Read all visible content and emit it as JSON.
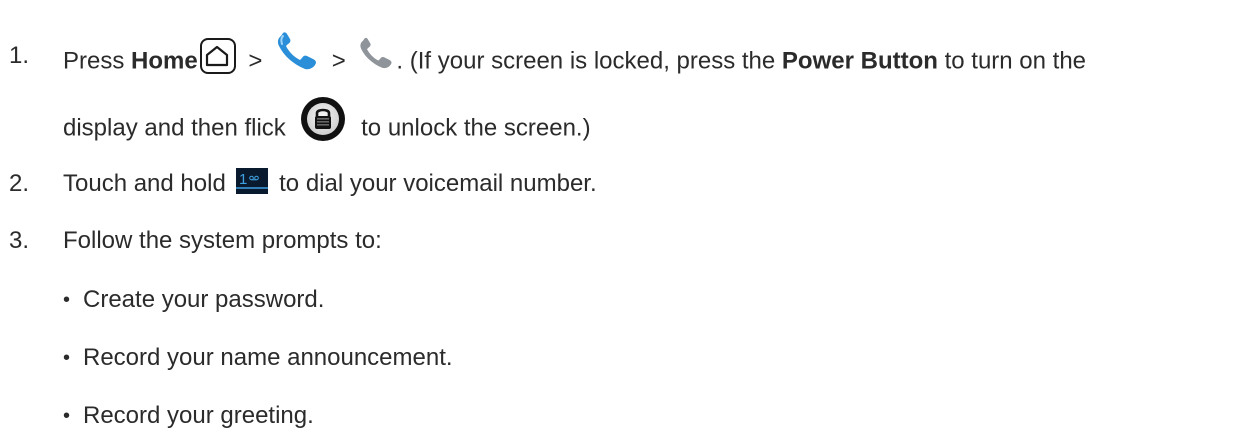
{
  "steps": [
    {
      "number": "1.",
      "parts": {
        "press": "Press ",
        "home_bold": "Home",
        "sep1": " > ",
        "sep2": " > ",
        "after_icons": ". (If your screen is locked, press the ",
        "power_bold": "Power Button",
        "after_power": " to turn on the",
        "line2_start": "display and then flick ",
        "line2_end": " to unlock the screen.)"
      }
    },
    {
      "number": "2.",
      "parts": {
        "start": "Touch and hold ",
        "end": " to dial your voicemail number."
      }
    },
    {
      "number": "3.",
      "parts": {
        "text": "Follow the system prompts to:"
      }
    }
  ],
  "bullets": [
    "Create your password.",
    "Record your name announcement.",
    "Record your greeting."
  ],
  "bullet_glyph": "•",
  "icons": {
    "home": "home-key-icon",
    "phone_app": "phone-app-icon",
    "phone_tab": "phone-tab-icon",
    "unlock": "unlock-icon",
    "voicemail_key": "voicemail-key-icon"
  },
  "colors": {
    "text": "#2b2b2b",
    "phone_blue": "#2a8fd8",
    "phone_grey": "#8e9499",
    "key_bg": "#0a1a2e",
    "key_accent": "#3fa0e0"
  }
}
